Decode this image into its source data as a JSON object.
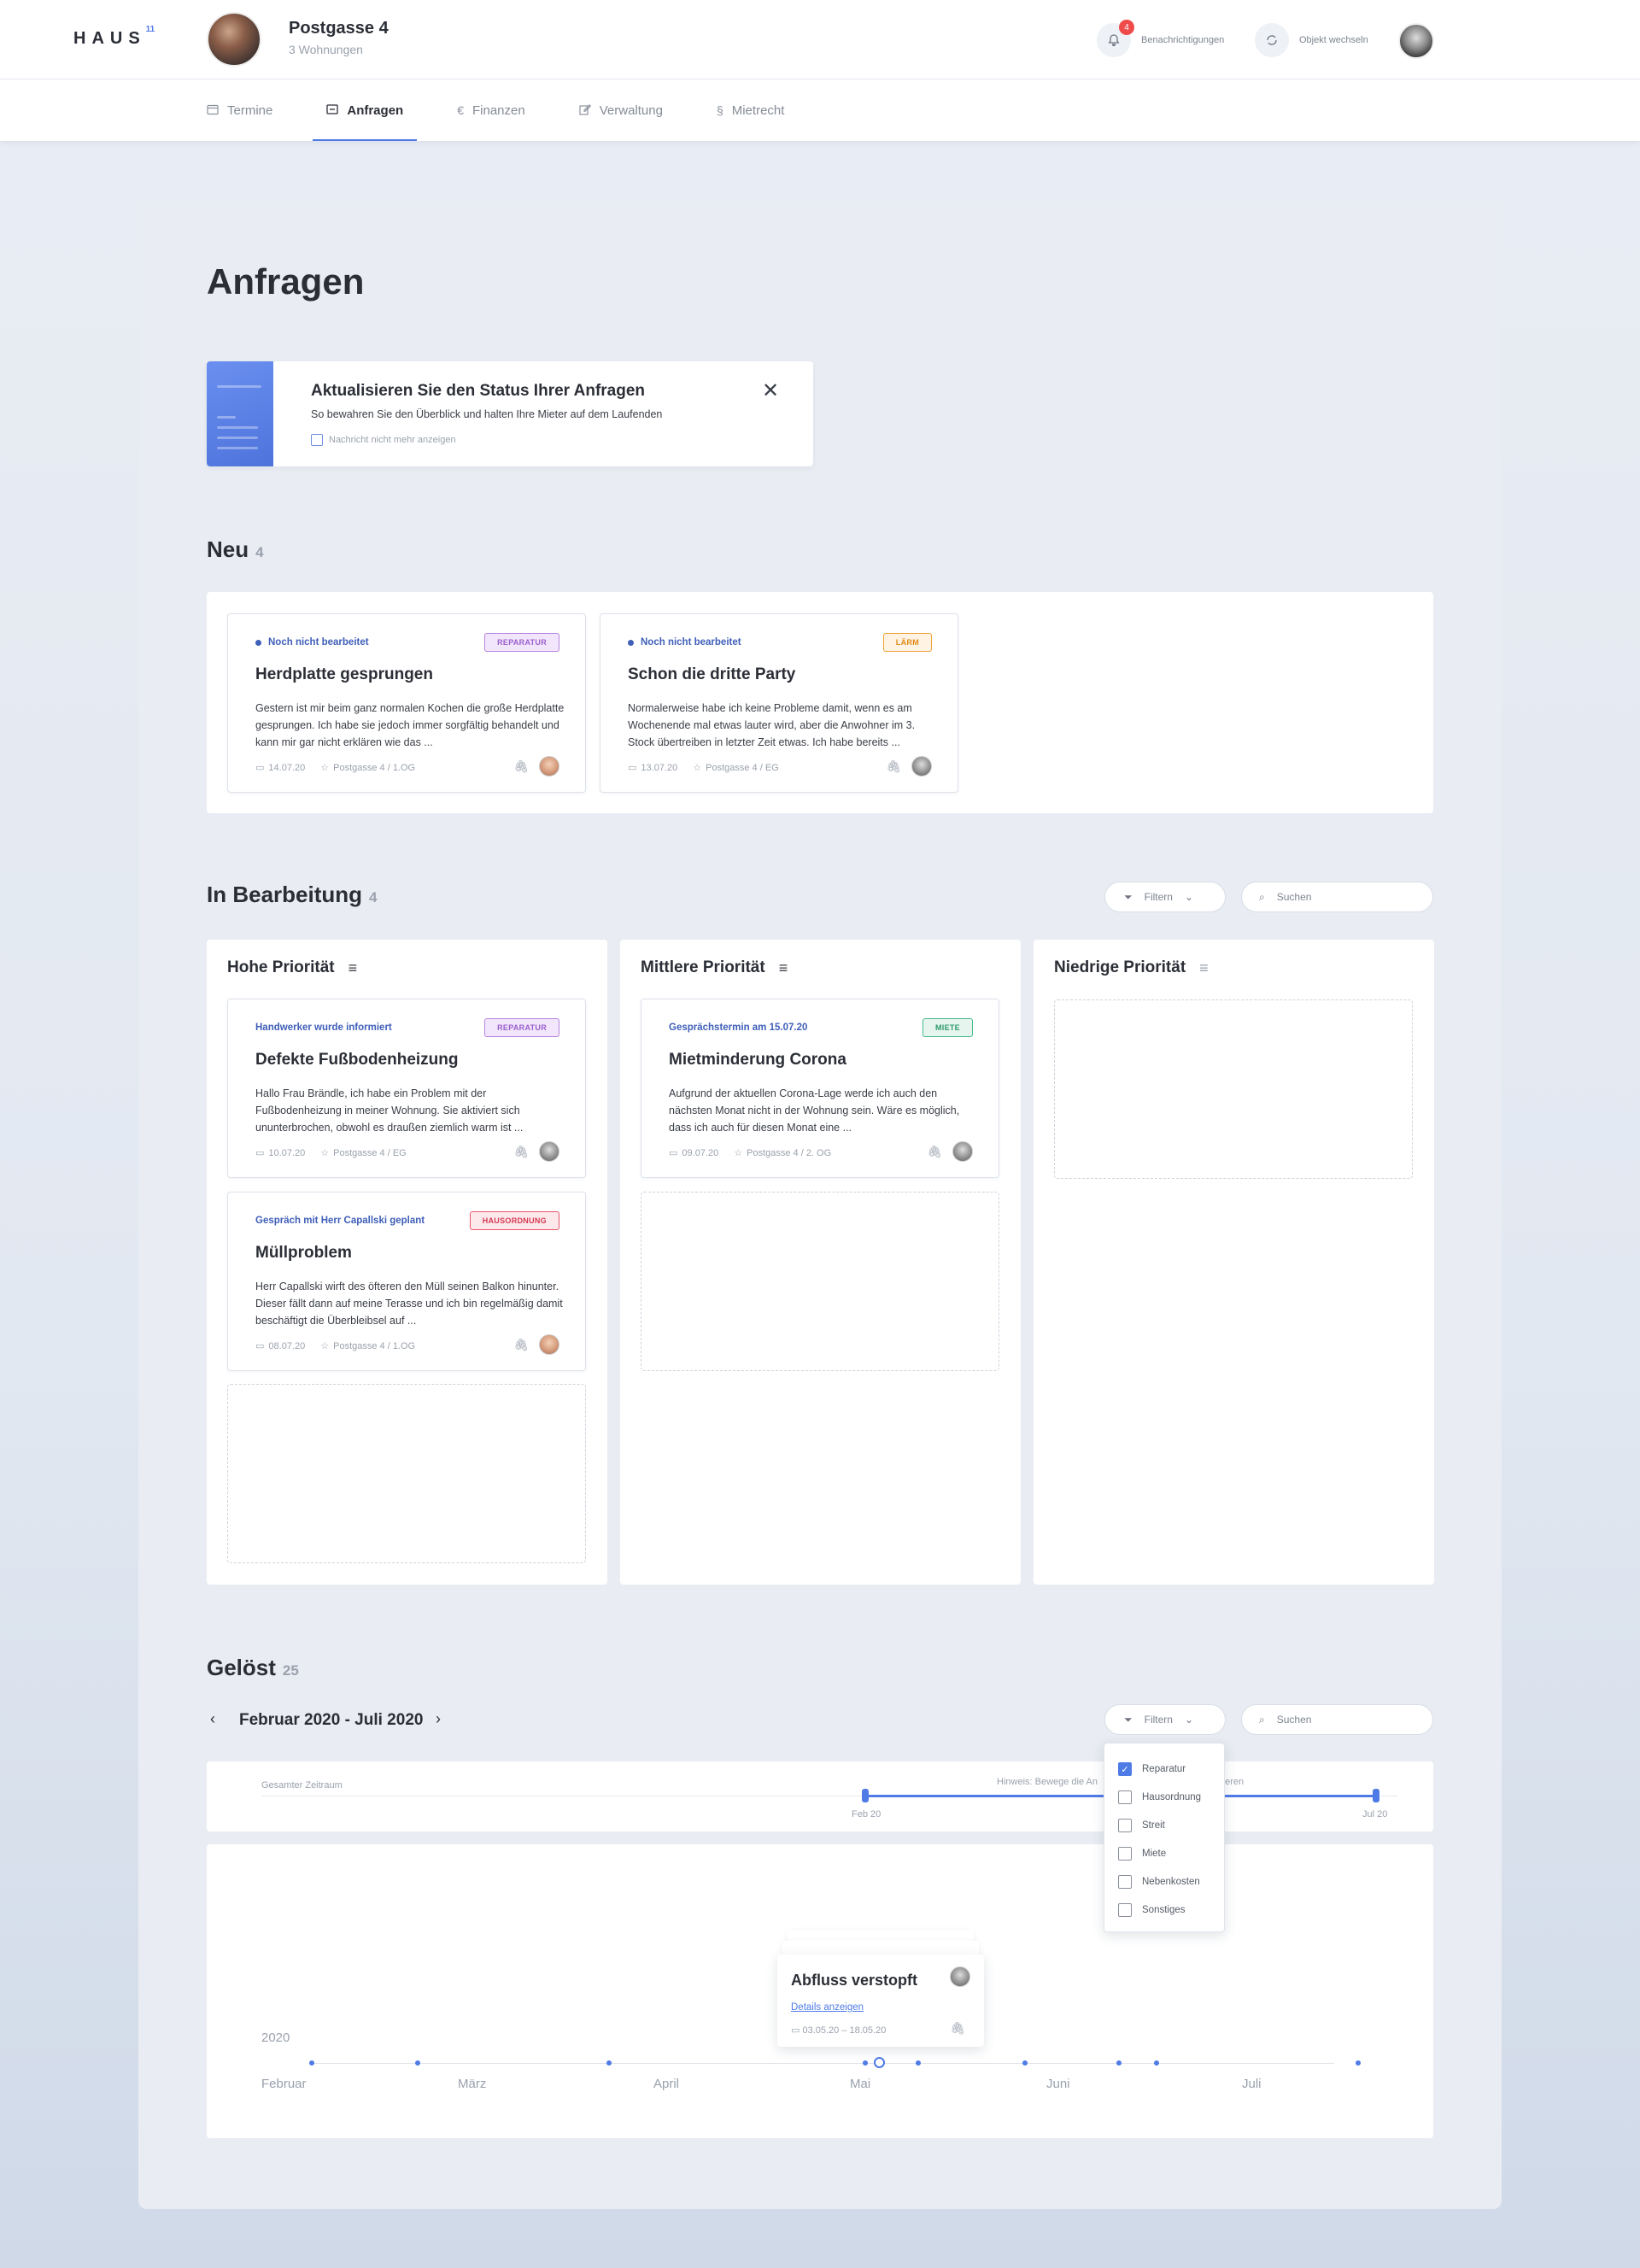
{
  "header": {
    "logo_text": "HAUS",
    "logo_sup": "11",
    "property_title": "Postgasse 4",
    "property_sub": "3 Wohnungen",
    "notifications_label": "Benachrichtigungen",
    "notifications_count": "4",
    "switch_label": "Objekt wechseln"
  },
  "nav": {
    "items": [
      {
        "label": "Termine",
        "icon": "calendar-icon"
      },
      {
        "label": "Anfragen",
        "icon": "inbox-icon"
      },
      {
        "label": "Finanzen",
        "icon": "euro-icon"
      },
      {
        "label": "Verwaltung",
        "icon": "edit-icon"
      },
      {
        "label": "Mietrecht",
        "icon": "paragraph-icon"
      }
    ],
    "active": "Anfragen"
  },
  "page": {
    "title": "Anfragen"
  },
  "hint": {
    "title": "Aktualisieren Sie den Status Ihrer Anfragen",
    "text": "So bewahren Sie den Überblick und halten Ihre Mieter auf dem Laufenden",
    "checkbox_label": "Nachricht nicht mehr anzeigen"
  },
  "neu": {
    "title": "Neu",
    "count": "4",
    "cards": [
      {
        "status": "Noch nicht bearbeitet",
        "tag": "REPARATUR",
        "title": "Herdplatte gesprungen",
        "body": "Gestern ist mir beim ganz normalen Kochen die große Herdplatte gesprungen. Ich habe sie jedoch immer sorgfältig behandelt und kann mir gar nicht erklären wie das ...",
        "date": "14.07.20",
        "location": "Postgasse 4 / 1.OG"
      },
      {
        "status": "Noch nicht bearbeitet",
        "tag": "LÄRM",
        "title": "Schon die dritte Party",
        "body": "Normalerweise habe ich keine Probleme damit, wenn es am Wochenende mal etwas lauter wird, aber die Anwohner im 3. Stock übertreiben in letzter Zeit etwas. Ich habe bereits ...",
        "date": "13.07.20",
        "location": "Postgasse 4 / EG"
      }
    ]
  },
  "bearbeitung": {
    "title": "In Bearbeitung",
    "count": "4",
    "filter_label": "Filtern",
    "search_placeholder": "Suchen",
    "columns": [
      {
        "title": "Hohe Priorität"
      },
      {
        "title": "Mittlere Priorität"
      },
      {
        "title": "Niedrige Priorität"
      }
    ],
    "cards": [
      {
        "status": "Handwerker wurde informiert",
        "tag": "REPARATUR",
        "title": "Defekte Fußbodenheizung",
        "body": "Hallo Frau Brändle, ich habe ein Problem mit der Fußbodenheizung in meiner Wohnung. Sie aktiviert sich ununterbrochen, obwohl es draußen ziemlich warm ist ...",
        "date": "10.07.20",
        "location": "Postgasse 4 / EG"
      },
      {
        "status": "Gespräch mit Herr Capallski geplant",
        "tag": "HAUSORDNUNG",
        "title": "Müllproblem",
        "body": "Herr Capallski wirft des öfteren den Müll seinen Balkon hinunter. Dieser fällt dann auf meine Terasse und ich bin regelmäßig damit beschäftigt die Überbleibsel auf ...",
        "date": "08.07.20",
        "location": "Postgasse 4 / 1.OG"
      },
      {
        "status": "Gesprächstermin am 15.07.20",
        "tag": "MIETE",
        "title": "Mietminderung Corona",
        "body": "Aufgrund der aktuellen Corona-Lage werde ich auch den nächsten Monat nicht in der Wohnung sein. Wäre es möglich, dass ich auch für diesen Monat eine ...",
        "date": "09.07.20",
        "location": "Postgasse 4 / 2. OG"
      }
    ]
  },
  "geloest": {
    "title": "Gelöst",
    "count": "25",
    "range_label": "Februar 2020 - Juli 2020",
    "filter_label": "Filtern",
    "search_placeholder": "Suchen",
    "range_bar": {
      "total_label": "Gesamter Zeitraum",
      "hint": "Hinweis: Bewege die An",
      "hint_tail": "geren",
      "start_label": "Feb 20",
      "end_label": "Jul 20"
    },
    "filter_options": [
      {
        "label": "Reparatur",
        "checked": true
      },
      {
        "label": "Hausordnung",
        "checked": false
      },
      {
        "label": "Streit",
        "checked": false
      },
      {
        "label": "Miete",
        "checked": false
      },
      {
        "label": "Nebenkosten",
        "checked": false
      },
      {
        "label": "Sonstiges",
        "checked": false
      }
    ],
    "timeline": {
      "year": "2020",
      "months": [
        "Februar",
        "März",
        "April",
        "Mai",
        "Juni",
        "Juli"
      ]
    },
    "popup": {
      "title": "Abfluss verstopft",
      "link": "Details anzeigen",
      "dates": "03.05.20 – 18.05.20"
    }
  },
  "colors": {
    "accent": "#4f7be6",
    "status_blue": "#3f5fb8",
    "badge_red": "#ef4b4b"
  }
}
